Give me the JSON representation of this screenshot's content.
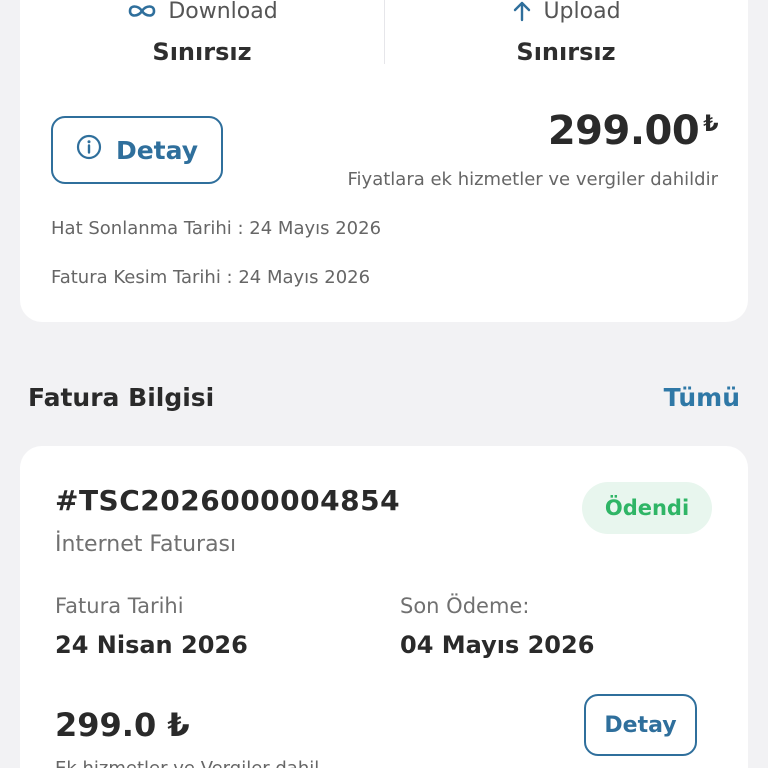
{
  "package": {
    "download": {
      "label": "Download",
      "value": "Sınırsız",
      "icon": "infinity-icon"
    },
    "upload": {
      "label": "Upload",
      "value": "Sınırsız",
      "icon": "arrow-up-icon"
    },
    "detail_label": "Detay",
    "price": "299.00",
    "currency": "₺",
    "price_note": "Fiyatlara ek hizmetler ve vergiler dahildir",
    "line_end_date": "Hat Sonlanma Tarihi : 24 Mayıs 2026",
    "billing_date": "Fatura Kesim Tarihi : 24 Mayıs 2026"
  },
  "invoice_section": {
    "title": "Fatura Bilgisi",
    "see_all": "Tümü"
  },
  "invoice": {
    "id": "#TSC2026000004854",
    "type": "İnternet Faturası",
    "status": "Ödendi",
    "invoice_date_label": "Fatura Tarihi",
    "invoice_date": "24 Nisan 2026",
    "due_date_label": "Son Ödeme:",
    "due_date": "04 Mayıs 2026",
    "amount": "299.0 ₺",
    "amount_note": "Ek hizmetler ve Vergiler dahil",
    "detail_label": "Detay"
  },
  "colors": {
    "accent": "#2f6f9c",
    "link": "#2f78a6",
    "success": "#2fb566",
    "success_bg": "#e8f6ee",
    "background": "#f2f2f4"
  }
}
